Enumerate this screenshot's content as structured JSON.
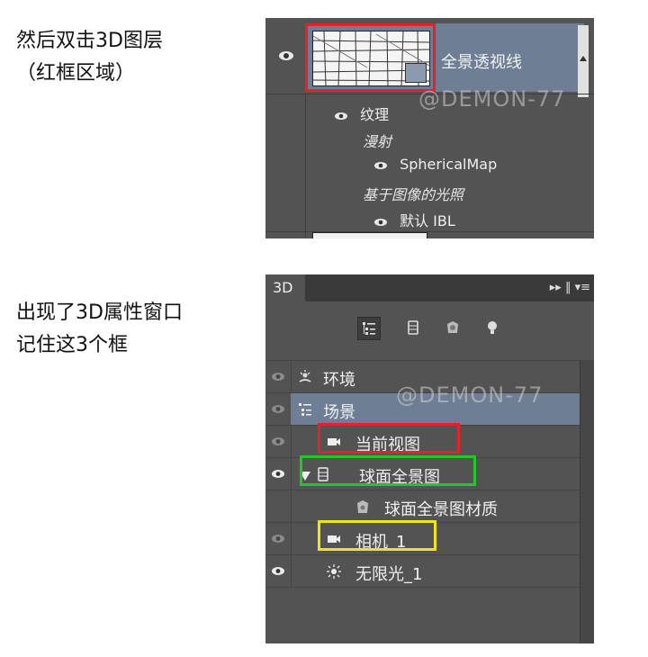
{
  "instructions": {
    "step1": [
      "然后双击3D图层",
      "（红框区域）"
    ],
    "step2": [
      "出现了3D属性窗口",
      "记住这3个框"
    ]
  },
  "layers_panel": {
    "layer_name": "全景透视线",
    "sub_texture": "纹理",
    "sub_mapping": "漫射",
    "sub_map": "SphericalMap",
    "sub_ibl_group": "基于图像的光照",
    "sub_ibl": "默认 IBL",
    "watermark": "@DEMON-77"
  },
  "panel3d": {
    "tab_label": "3D",
    "tab_icons": "▸▸ ‖ ▾≡",
    "watermark": "@DEMON-77",
    "rows": [
      {
        "label": "环境"
      },
      {
        "label": "场景"
      },
      {
        "label": "当前视图"
      },
      {
        "label": "球面全景图"
      },
      {
        "label": "球面全景图材质"
      },
      {
        "label": "相机_1"
      },
      {
        "label": "无限光_1"
      }
    ]
  },
  "colors": {
    "panel_bg": "#535353",
    "selection": "#6e7e95",
    "highlight_red": "#e8202a",
    "highlight_green": "#22c82b",
    "highlight_yellow": "#f0e21d"
  }
}
